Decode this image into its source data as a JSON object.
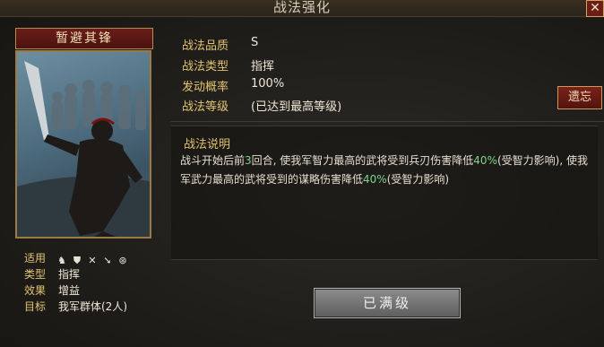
{
  "window": {
    "title": "战法强化",
    "close_label": "✕"
  },
  "skill": {
    "name": "暂避其锋",
    "quality_label": "战法品质",
    "quality_value": "S",
    "type_label": "战法类型",
    "type_value": "指挥",
    "rate_label": "发动概率",
    "rate_value": "100%",
    "level_label": "战法等级",
    "level_value": "(已达到最高等级)"
  },
  "forget_button": "遗忘",
  "description": {
    "title": "战法说明",
    "part1": "战斗开始后前",
    "highlight1": "3",
    "part2": "回合, 使我军智力最高的武将受到兵刃伤害降低",
    "highlight2": "40%",
    "part3": "(受智力影响), 使我军武力最高的武将受到的谋略伤害降低",
    "highlight3": "40%",
    "part4": "(受智力影响)"
  },
  "stats": {
    "applicable_label": "适用",
    "applicable_icons": [
      "cavalry-icon",
      "shield-icon",
      "bow-icon",
      "spear-icon",
      "siege-icon"
    ],
    "category_label": "类型",
    "category_value": "指挥",
    "effect_label": "效果",
    "effect_value": "增益",
    "target_label": "目标",
    "target_value": "我军群体(2人)"
  },
  "max_button": "已满级",
  "colors": {
    "accent": "#e1c470",
    "highlight": "#7fd48a",
    "button_red": "#6e1c16"
  }
}
